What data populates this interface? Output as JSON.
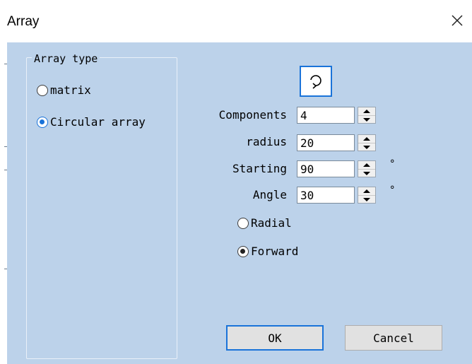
{
  "window": {
    "title": "Array"
  },
  "array_type": {
    "legend": "Array type",
    "options": [
      {
        "label": "matrix",
        "selected": false
      },
      {
        "label": "Circular array",
        "selected": true
      }
    ]
  },
  "rotate_button": {
    "icon": "rotate-clockwise-icon"
  },
  "fields": [
    {
      "label": "Components",
      "value": "4",
      "unit": ""
    },
    {
      "label": "radius",
      "value": "20",
      "unit": ""
    },
    {
      "label": "Starting",
      "value": "90",
      "unit": "°"
    },
    {
      "label": "Angle",
      "value": "30",
      "unit": "°"
    }
  ],
  "direction": {
    "options": [
      {
        "label": "Radial",
        "selected": false
      },
      {
        "label": "Forward",
        "selected": true
      }
    ]
  },
  "buttons": {
    "ok": "OK",
    "cancel": "Cancel"
  },
  "colors": {
    "client_bg": "#bcd2ea",
    "accent": "#1a73d9"
  }
}
